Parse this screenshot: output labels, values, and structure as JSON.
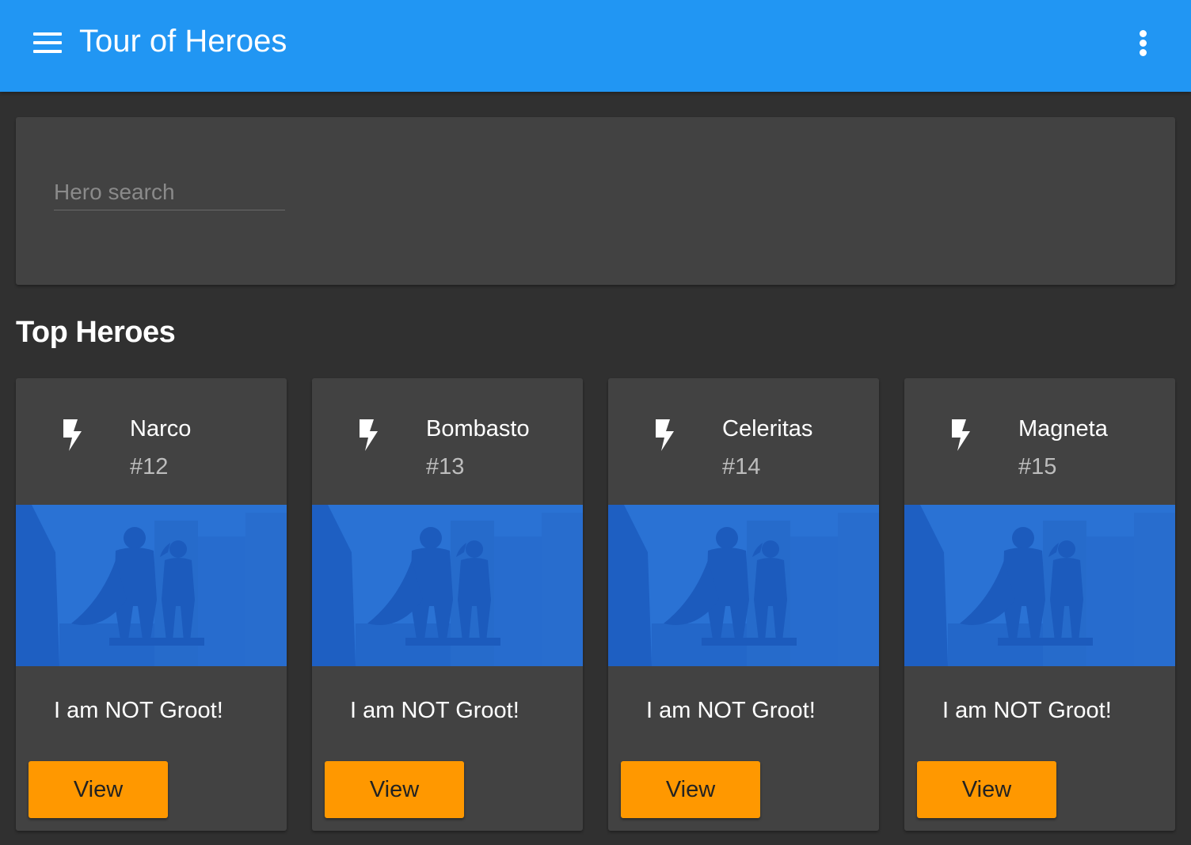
{
  "toolbar": {
    "title": "Tour of Heroes",
    "color": "#2196f3",
    "menu_icon": "hamburger-menu-icon",
    "more_icon": "more-vertical-icon"
  },
  "search": {
    "placeholder": "Hero search",
    "value": ""
  },
  "section": {
    "title": "Top Heroes"
  },
  "heroes": [
    {
      "name": "Narco",
      "id": "#12",
      "quote": "I am NOT Groot!",
      "button_label": "View",
      "icon": "bolt-icon"
    },
    {
      "name": "Bombasto",
      "id": "#13",
      "quote": "I am NOT Groot!",
      "button_label": "View",
      "icon": "bolt-icon"
    },
    {
      "name": "Celeritas",
      "id": "#14",
      "quote": "I am NOT Groot!",
      "button_label": "View",
      "icon": "bolt-icon"
    },
    {
      "name": "Magneta",
      "id": "#15",
      "quote": "I am NOT Groot!",
      "button_label": "View",
      "icon": "bolt-icon"
    }
  ],
  "colors": {
    "background": "#303030",
    "card": "#424242",
    "accent": "#ff9800",
    "hero_image": "#2a72d4"
  }
}
